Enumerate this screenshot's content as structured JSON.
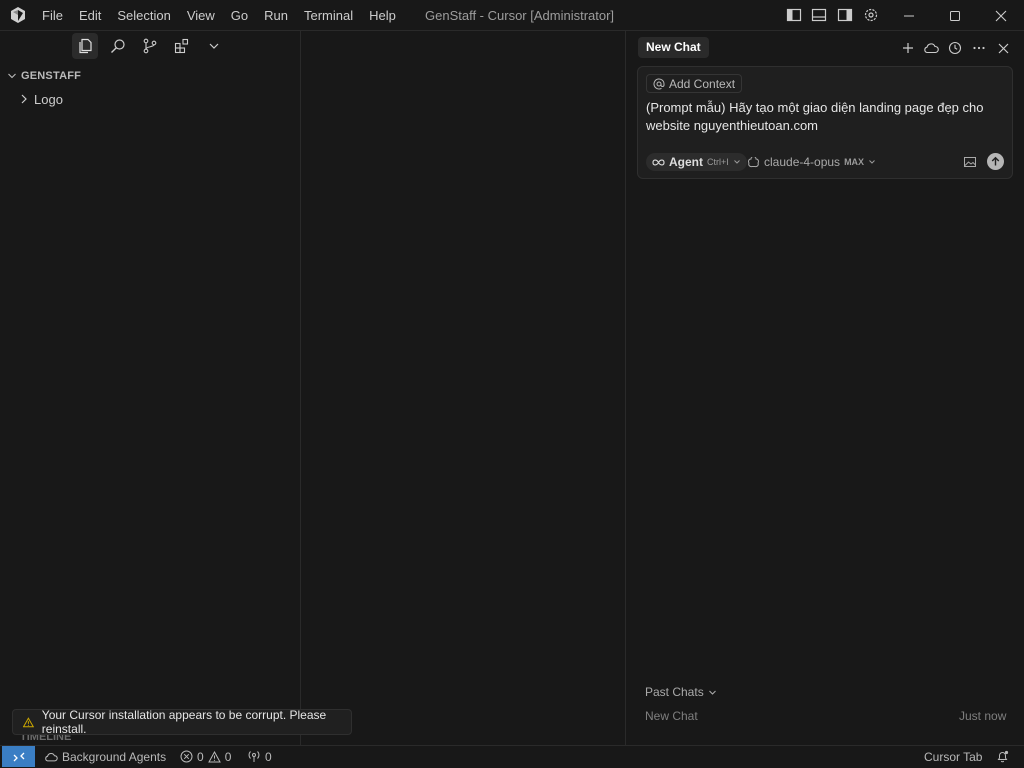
{
  "menu": [
    "File",
    "Edit",
    "Selection",
    "View",
    "Go",
    "Run",
    "Terminal",
    "Help"
  ],
  "window_title": "GenStaff - Cursor [Administrator]",
  "explorer": {
    "section_title": "GENSTAFF",
    "items": [
      {
        "label": "Logo"
      }
    ],
    "timeline_title": "TIMELINE"
  },
  "chat": {
    "tab_label": "New Chat",
    "add_context_label": "Add Context",
    "prompt_text": "(Prompt mẫu) Hãy tạo một giao diện landing page đẹp cho website nguyenthieutoan.com",
    "mode_label": "Agent",
    "mode_shortcut": "Ctrl+I",
    "model_label": "claude-4-opus",
    "model_badge": "MAX",
    "past_chats_label": "Past Chats",
    "past_chats": [
      {
        "title": "New Chat",
        "time": "Just now"
      }
    ]
  },
  "notification": {
    "message": "Your Cursor installation appears to be corrupt. Please reinstall."
  },
  "statusbar": {
    "background_agents_label": "Background Agents",
    "errors_count": "0",
    "warnings_count": "0",
    "ports_count": "0",
    "cursor_tab_label": "Cursor Tab"
  },
  "colors": {
    "background": "#181818",
    "accent_remote": "#3a7ec4",
    "warning": "#cca700"
  },
  "icons": [
    "cursor-logo-icon",
    "files-icon",
    "search-icon",
    "source-control-icon",
    "extensions-icon",
    "chevron-down-icon",
    "chevron-right-icon",
    "toggle-primary-sidebar-icon",
    "toggle-panel-icon",
    "toggle-secondary-sidebar-icon",
    "settings-gear-icon",
    "minimize-icon",
    "maximize-icon",
    "close-icon",
    "plus-icon",
    "cloud-icon",
    "history-icon",
    "more-icon",
    "at-icon",
    "infinity-icon",
    "model-brain-icon",
    "image-icon",
    "send-arrow-icon",
    "warning-icon",
    "remote-icon",
    "error-icon",
    "ports-icon",
    "bell-icon"
  ]
}
